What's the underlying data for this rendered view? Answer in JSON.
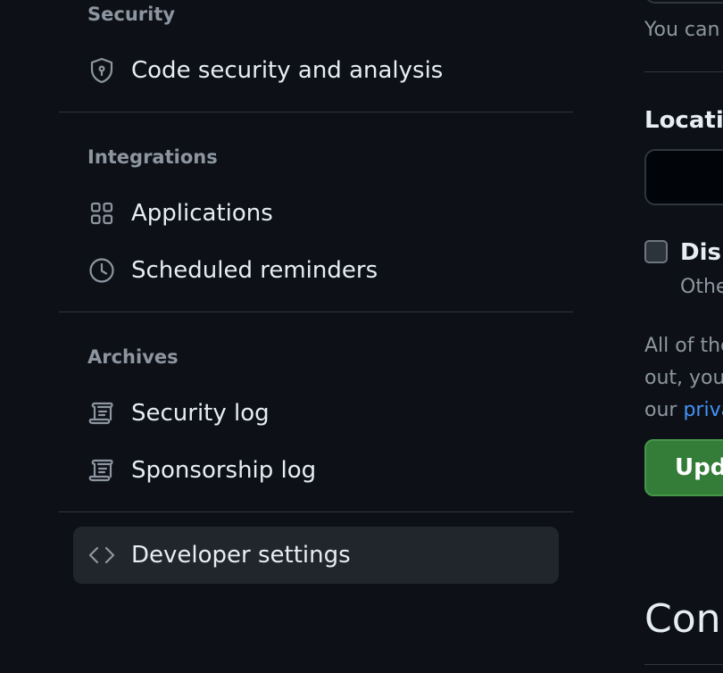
{
  "sidebar": {
    "sections": [
      {
        "heading": "Security",
        "items": [
          {
            "label": "Code security and analysis",
            "icon": "shield-lock-icon"
          }
        ]
      },
      {
        "heading": "Integrations",
        "items": [
          {
            "label": "Applications",
            "icon": "apps-grid-icon"
          },
          {
            "label": "Scheduled reminders",
            "icon": "clock-icon"
          }
        ]
      },
      {
        "heading": "Archives",
        "items": [
          {
            "label": "Security log",
            "icon": "log-icon"
          },
          {
            "label": "Sponsorship log",
            "icon": "log-icon"
          }
        ]
      }
    ],
    "developer_settings": {
      "label": "Developer settings",
      "icon": "code-icon",
      "selected": true
    }
  },
  "main": {
    "top_note": "You can",
    "location_label": "Locatio",
    "location_value": "",
    "checkbox": {
      "label": "Disp",
      "hint": "Othe",
      "checked": false
    },
    "paragraph": {
      "line1": "All of the",
      "line2": "out, you",
      "line3_prefix": "our ",
      "line3_link": "priva"
    },
    "update_button": "Upd",
    "next_section_heading": "Con"
  },
  "colors": {
    "background": "#0d1117",
    "muted_text": "#8d96a0",
    "link": "#4493f8",
    "primary_button": "#347d39",
    "selected_item_bg": "#21262d"
  }
}
